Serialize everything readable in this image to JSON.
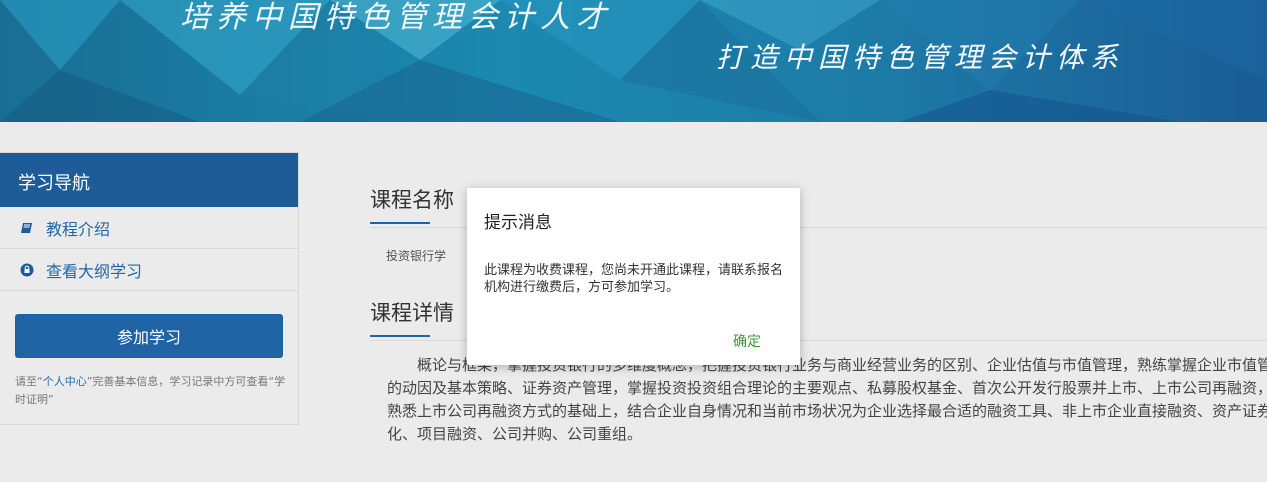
{
  "banner": {
    "slogan_left": "培养中国特色管理会计人才",
    "slogan_right": "打造中国特色管理会计体系"
  },
  "sidebar": {
    "title": "学习导航",
    "items": [
      {
        "label": "教程介绍",
        "icon": "book-icon"
      },
      {
        "label": "查看大纲学习",
        "icon": "outline-icon"
      }
    ],
    "join_button": "参加学习",
    "note_prefix": "请至“",
    "note_link": "个人中心",
    "note_suffix": "”完善基本信息，学习记录中方可查看“学时证明”"
  },
  "main": {
    "course_name_title": "课程名称",
    "course_name": "投资银行学",
    "course_detail_title": "课程详情",
    "description": "概论与框架，掌握投资银行的多维度概念，把握投资银行业务与商业经营业务的区别、企业估值与市值管理，熟练掌握企业市值管理的动因及基本策略、证券资产管理，掌握投资投资组合理论的主要观点、私募股权基金、首次公开发行股票并上市、上市公司再融资，在熟悉上市公司再融资方式的基础上，结合企业自身情况和当前市场状况为企业选择最合适的融资工具、非上市企业直接融资、资产证券化、项目融资、公司并购、公司重组。"
  },
  "modal": {
    "title": "提示消息",
    "body": "此课程为收费课程，您尚未开通此课程，请联系报名机构进行缴费后，方可参加学习。",
    "ok": "确定"
  },
  "colors": {
    "nav_header": "#1e5c97",
    "link": "#1f67a8",
    "confirm": "#3a9b3a"
  }
}
